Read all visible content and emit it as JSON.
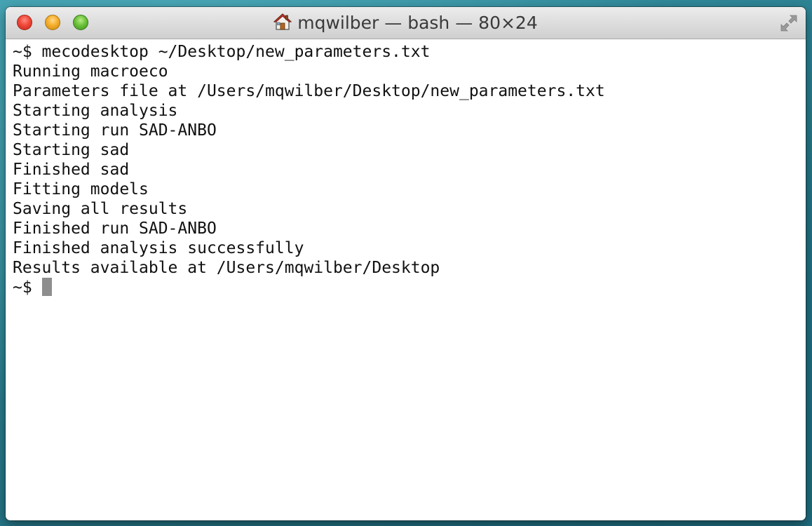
{
  "window": {
    "title": "mqwilber — bash — 80×24"
  },
  "terminal": {
    "lines": [
      "~$ mecodesktop ~/Desktop/new_parameters.txt",
      "Running macroeco",
      "Parameters file at /Users/mqwilber/Desktop/new_parameters.txt",
      "Starting analysis",
      "Starting run SAD-ANBO",
      "Starting sad",
      "Finished sad",
      "Fitting models",
      "Saving all results",
      "Finished run SAD-ANBO",
      "Finished analysis successfully",
      "Results available at /Users/mqwilber/Desktop"
    ],
    "prompt": "~$ "
  },
  "icons": {
    "title_icon": "home-icon",
    "fullscreen": "fullscreen-arrows-icon"
  },
  "colors": {
    "close": "#f0483a",
    "minimize": "#f5ae2b",
    "zoom": "#6cc23a",
    "cursor": "#8e8e8e"
  }
}
